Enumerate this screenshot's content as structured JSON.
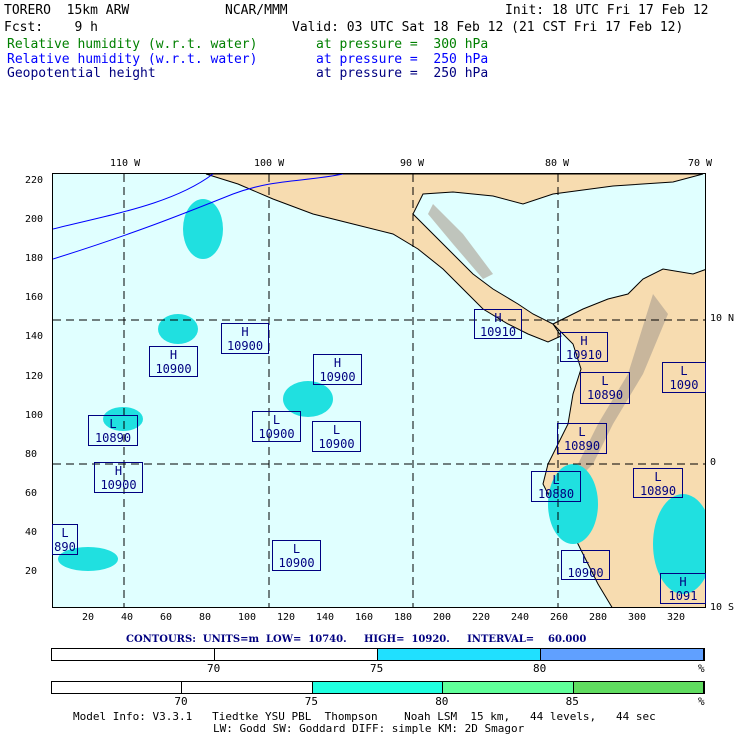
{
  "header": {
    "model": "TORERO  15km ARW",
    "org": "NCAR/MMM",
    "init": "Init: 18 UTC Fri 17 Feb 12",
    "fcst": "Fcst:    9 h",
    "valid": "Valid: 03 UTC Sat 18 Feb 12 (21 CST Fri 17 Feb 12)"
  },
  "fields": [
    {
      "name": "Relative humidity (w.r.t. water)",
      "level": "at pressure =  300 hPa",
      "color": "#008000"
    },
    {
      "name": "Relative humidity (w.r.t. water)",
      "level": "at pressure =  250 hPa",
      "color": "#0000ff"
    },
    {
      "name": "Geopotential height",
      "level": "at pressure =  250 hPa",
      "color": "#000080"
    }
  ],
  "axes": {
    "top": [
      "110 W",
      "100 W",
      "90 W",
      "80 W",
      "70 W"
    ],
    "right": [
      "10 N",
      "0",
      "10 S"
    ],
    "left": [
      "220",
      "200",
      "180",
      "160",
      "140",
      "120",
      "100",
      "80",
      "60",
      "40",
      "20"
    ],
    "bottom": [
      "20",
      "40",
      "60",
      "80",
      "100",
      "120",
      "140",
      "160",
      "180",
      "200",
      "220",
      "240",
      "260",
      "280",
      "300",
      "320"
    ]
  },
  "centers": [
    {
      "type": "H",
      "value": "10910"
    },
    {
      "type": "H",
      "value": "10910"
    },
    {
      "type": "L",
      "value": "10890"
    },
    {
      "type": "L",
      "value": "1090"
    },
    {
      "type": "L",
      "value": "10890"
    },
    {
      "type": "L",
      "value": "10880"
    },
    {
      "type": "L",
      "value": "10890"
    },
    {
      "type": "L",
      "value": "10900"
    },
    {
      "type": "H",
      "value": "1091"
    },
    {
      "type": "H",
      "value": "10900"
    },
    {
      "type": "H",
      "value": "10900"
    },
    {
      "type": "H",
      "value": "10900"
    },
    {
      "type": "L",
      "value": "10890"
    },
    {
      "type": "L",
      "value": "10900"
    },
    {
      "type": "L",
      "value": "10900"
    },
    {
      "type": "H",
      "value": "10900"
    },
    {
      "type": "L",
      "value": "10900"
    },
    {
      "type": "L",
      "value": "890"
    }
  ],
  "contours": "CONTOURS:  UNITS=m  LOW=  10740.     HIGH=  10920.     INTERVAL=    60.000",
  "colorbar1": {
    "labels": [
      "70",
      "75",
      "80",
      "%"
    ],
    "colors": [
      "#ffffff",
      "#ffffff",
      "#20e0ff",
      "#60a0ff"
    ]
  },
  "colorbar2": {
    "labels": [
      "70",
      "75",
      "80",
      "85",
      "%"
    ],
    "colors": [
      "#ffffff",
      "#ffffff",
      "#20ffe0",
      "#60ff9a",
      "#60dc60"
    ]
  },
  "footer": {
    "line1": "Model Info: V3.3.1   Tiedtke YSU PBL  Thompson    Noah LSM  15 km,   44 levels,   44 sec",
    "line2": "LW: Godd SW: Goddard DIFF: simple KM: 2D Smagor"
  }
}
